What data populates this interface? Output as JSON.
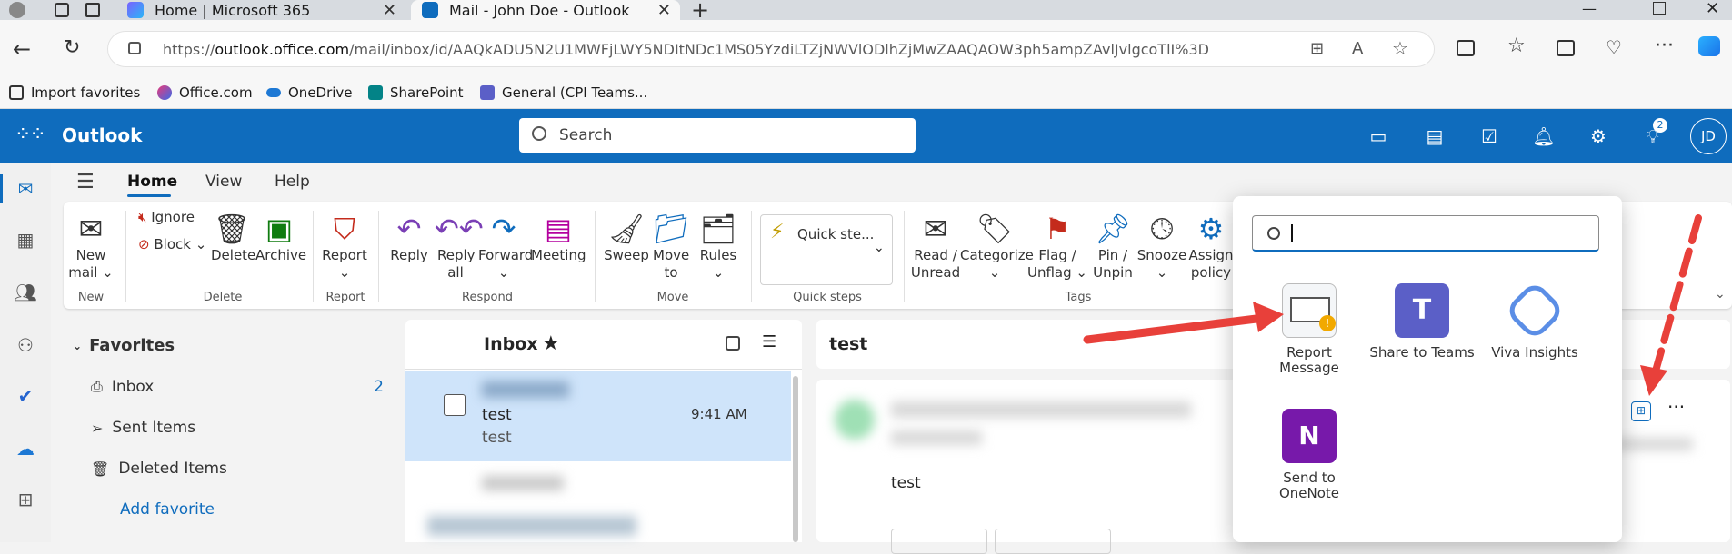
{
  "browser": {
    "tabs": [
      {
        "label": "Home | Microsoft 365",
        "active": false
      },
      {
        "label": "Mail - John Doe - Outlook",
        "active": true
      }
    ],
    "new_tab_label": "+",
    "url_prefix": "https://",
    "url_host": "outlook.office.com",
    "url_path": "/mail/inbox/id/AAQkADU5N2U1MWFjLWY5NDItNDc1MS05YzdiLTZjNWVlODlhZjMwZAAQAOW3ph5ampZAvlJvlgcoTlI%3D",
    "bookmarks": [
      "Import favorites",
      "Office.com",
      "OneDrive",
      "SharePoint",
      "General (CPI Teams..."
    ]
  },
  "outlook": {
    "app_name": "Outlook",
    "search_placeholder": "Search",
    "notification_badge": "2",
    "user_initials": "JD",
    "accent_color": "#0f6cbd"
  },
  "ribbon": {
    "tabs": [
      "Home",
      "View",
      "Help"
    ],
    "active_tab": "Home",
    "buttons": {
      "new_mail": "New mail",
      "ignore": "Ignore",
      "block": "Block",
      "delete": "Delete",
      "archive": "Archive",
      "report": "Report",
      "reply": "Reply",
      "reply_all": "Reply all",
      "forward": "Forward",
      "meeting": "Meeting",
      "sweep": "Sweep",
      "move_to": "Move to",
      "rules": "Rules",
      "quick_steps": "Quick ste...",
      "read_unread": "Read / Unread",
      "categorize": "Categorize",
      "flag_unflag": "Flag / Unflag",
      "pin_unpin": "Pin / Unpin",
      "snooze": "Snooze",
      "assign_policy": "Assign policy"
    },
    "groups": [
      "New",
      "Delete",
      "Report",
      "Respond",
      "Move",
      "Quick steps",
      "Tags"
    ]
  },
  "folders": {
    "section": "Favorites",
    "items": [
      {
        "label": "Inbox",
        "count": "2"
      },
      {
        "label": "Sent Items",
        "count": ""
      },
      {
        "label": "Deleted Items",
        "count": ""
      }
    ],
    "add_favorite": "Add favorite"
  },
  "message_list": {
    "title": "Inbox",
    "selected": {
      "subject": "test",
      "preview": "test",
      "time": "9:41 AM"
    }
  },
  "reading_pane": {
    "subject": "test",
    "body": "test"
  },
  "addins_popup": {
    "items": [
      "Report Message",
      "Share to Teams",
      "Viva Insights",
      "Send to OneNote"
    ]
  }
}
